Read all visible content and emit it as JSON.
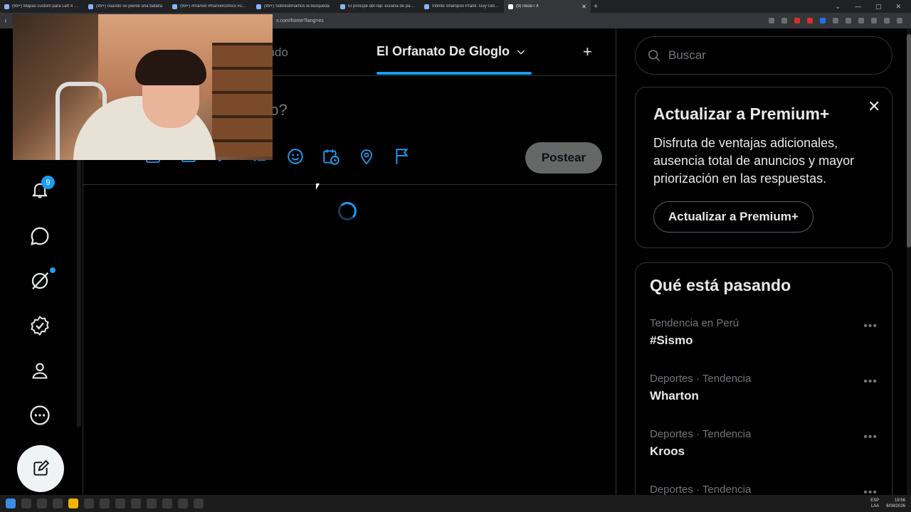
{
  "browser": {
    "tabs": [
      {
        "label": "(99+) Mapas custom para Left 4 Dead",
        "active": false
      },
      {
        "label": "(99+) cuando se pierde una batalla",
        "active": false
      },
      {
        "label": "(99+) #marvel #marvelcomics #spide",
        "active": false
      },
      {
        "label": "(99+) Sobrestimamos la búsqueda",
        "active": false
      },
      {
        "label": "El principe del rap: escena de padre",
        "active": false
      },
      {
        "label": "Infinite Shampoo Prank: Guy Gets Em",
        "active": false
      },
      {
        "label": "(9) Inicio / X",
        "active": true
      }
    ],
    "url": "x.com/home?lang=es",
    "window_controls": [
      "⌄",
      "—",
      "▢",
      "✕"
    ]
  },
  "home_tabs": {
    "for_you": "endo",
    "list": "El Orfanato De Gloglo",
    "add": "+"
  },
  "composer": {
    "placeholder": "do?",
    "post_label": "Postear"
  },
  "left_nav": {
    "notifications_count": "9"
  },
  "search": {
    "placeholder": "Buscar"
  },
  "premium": {
    "title": "Actualizar a Premium+",
    "text": "Disfruta de ventajas adicionales, ausencia total de anuncios y mayor priorización en las respuestas.",
    "button": "Actualizar a Premium+",
    "close": "✕"
  },
  "trends": {
    "title": "Qué está pasando",
    "items": [
      {
        "meta": "Tendencia en Perú",
        "name": "#Sismo"
      },
      {
        "meta": "Deportes · Tendencia",
        "name": "Wharton"
      },
      {
        "meta": "Deportes · Tendencia",
        "name": "Kroos"
      },
      {
        "meta": "Deportes · Tendencia",
        "name": ""
      }
    ],
    "more": "•••"
  },
  "taskbar": {
    "lang_top": "ESP",
    "lang_bottom": "LAA",
    "time": "19:56",
    "date": "6/08/2026"
  },
  "colors": {
    "accent": "#1d9bf0",
    "background": "#000000",
    "border": "#2f3336",
    "muted_text": "#71767b"
  }
}
